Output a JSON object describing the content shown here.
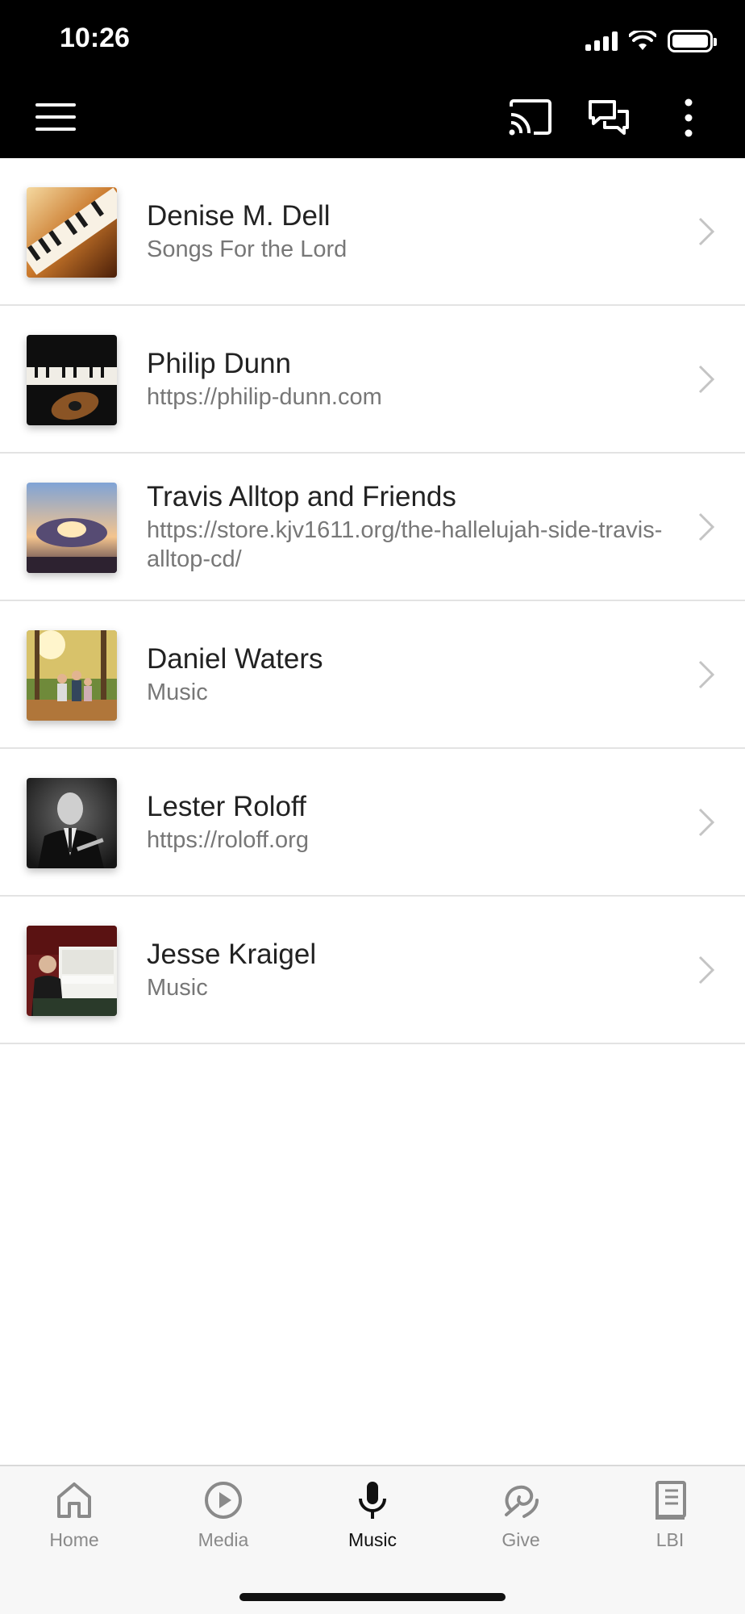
{
  "status_bar": {
    "time": "10:26"
  },
  "header": {
    "menu_icon": "hamburger-menu-icon",
    "cast_icon": "cast-icon",
    "chat_icon": "chat-bubbles-icon",
    "more_icon": "more-vertical-icon",
    "background": "#000000"
  },
  "list": {
    "items": [
      {
        "title": "Denise M. Dell",
        "subtitle": "Songs For the Lord"
      },
      {
        "title": "Philip Dunn",
        "subtitle": "https://philip-dunn.com"
      },
      {
        "title": "Travis Alltop and Friends",
        "subtitle": "https://store.kjv1611.org/the-hallelujah-side-travis-alltop-cd/"
      },
      {
        "title": "Daniel Waters",
        "subtitle": "Music"
      },
      {
        "title": "Lester Roloff",
        "subtitle": "https://roloff.org"
      },
      {
        "title": "Jesse Kraigel",
        "subtitle": "Music"
      }
    ]
  },
  "tabs": [
    {
      "label": "Home",
      "icon": "home-icon",
      "active": false
    },
    {
      "label": "Media",
      "icon": "play-circle-icon",
      "active": false
    },
    {
      "label": "Music",
      "icon": "microphone-icon",
      "active": true
    },
    {
      "label": "Give",
      "icon": "give-icon",
      "active": false
    },
    {
      "label": "LBI",
      "icon": "book-icon",
      "active": false
    }
  ],
  "colors": {
    "active_tab": "#111111",
    "inactive_tab": "#8a8a8a",
    "title_text": "#222222",
    "subtitle_text": "#777777"
  }
}
